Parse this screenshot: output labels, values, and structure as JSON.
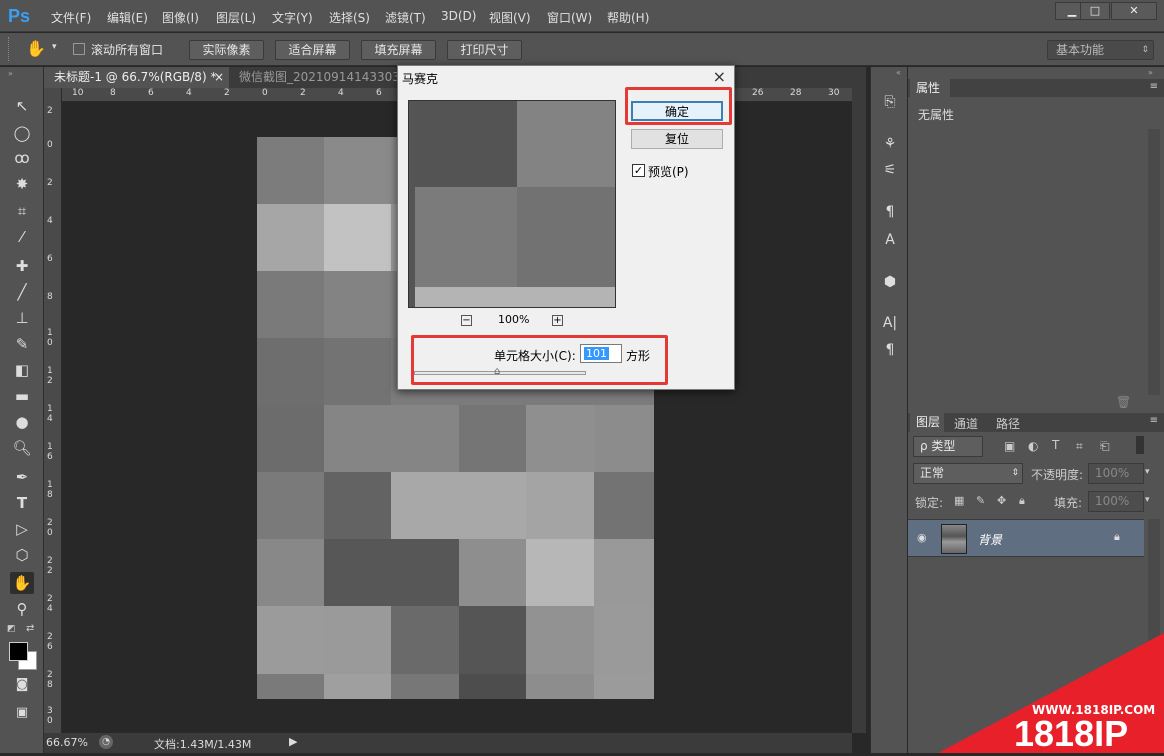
{
  "app": {
    "logo": "Ps"
  },
  "menu": [
    "文件(F)",
    "编辑(E)",
    "图像(I)",
    "图层(L)",
    "文字(Y)",
    "选择(S)",
    "滤镜(T)",
    "3D(D)",
    "视图(V)",
    "窗口(W)",
    "帮助(H)"
  ],
  "window_controls": {
    "minimize": "▁",
    "maximize": "□",
    "close": "✕"
  },
  "options_bar": {
    "tool_icon": "hand-icon",
    "scroll_all_label": "滚动所有窗口",
    "scroll_all_checked": false,
    "buttons": [
      "实际像素",
      "适合屏幕",
      "填充屏幕",
      "打印尺寸"
    ],
    "workspace": "基本功能"
  },
  "tabs": [
    {
      "label": "未标题-1 @ 66.7%(RGB/8) *",
      "close": "×"
    },
    {
      "label": "微信截图_20210914143303..",
      "close": ""
    }
  ],
  "ruler_h": [
    "10",
    "8",
    "6",
    "4",
    "2",
    "0",
    "2",
    "4",
    "6",
    "26",
    "28",
    "30"
  ],
  "ruler_v": [
    "2",
    "0",
    "2",
    "4",
    "6",
    "8",
    "1 0",
    "1 2",
    "1 4",
    "1 6",
    "1 8",
    "2 0",
    "2 2",
    "2 4",
    "2 6",
    "2 8",
    "3 0"
  ],
  "mosaic": {
    "colors": [
      [
        "#7c7c7c",
        "#8a8a8a",
        "#8a8a8a",
        "#8a8a8a",
        "#8a8a8a",
        "#8a8a8a"
      ],
      [
        "#a6a6a6",
        "#c2c2c2",
        "#9a9a9a",
        "#9a9a9a",
        "#9a9a9a",
        "#9a9a9a"
      ],
      [
        "#7a7a7a",
        "#838383",
        "#808080",
        "#808080",
        "#808080",
        "#808080"
      ],
      [
        "#6e6e6e",
        "#737373",
        "#7c7c7c",
        "#7c7c7c",
        "#7c7c7c",
        "#7c7c7c"
      ],
      [
        "#6c6c6c",
        "#858585",
        "#858585",
        "#757575",
        "#8f8f8f",
        "#8c8c8c"
      ],
      [
        "#7a7a7a",
        "#636363",
        "#a8a8a8",
        "#a8a8a8",
        "#a4a4a4",
        "#737373"
      ],
      [
        "#888888",
        "#575757",
        "#575757",
        "#8e8e8e",
        "#b7b7b7",
        "#999999"
      ],
      [
        "#9b9b9b",
        "#9a9a9a",
        "#6a6a6a",
        "#555555",
        "#929292",
        "#9a9a9a"
      ],
      [
        "#7a7a7a",
        "#9f9f9f",
        "#777777",
        "#4d4d4d",
        "#8d8d8d",
        "#9b9b9b"
      ]
    ]
  },
  "status": {
    "zoom": "66.67%",
    "doc": "文档:1.43M/1.43M"
  },
  "properties_panel": {
    "title": "属性",
    "content": "无属性"
  },
  "layers_panel": {
    "tabs": [
      "图层",
      "通道",
      "路径"
    ],
    "kind_filter": "ρ 类型",
    "blend_mode": "正常",
    "opacity_label": "不透明度:",
    "opacity_value": "100%",
    "lock_label": "锁定:",
    "fill_label": "填充:",
    "fill_value": "100%",
    "layers": [
      {
        "name": "背景",
        "locked": true,
        "visible": true
      }
    ]
  },
  "dialog": {
    "title": "马赛克",
    "close": "×",
    "ok_label": "确定",
    "reset_label": "复位",
    "preview_label": "预览(P)",
    "preview_checked": true,
    "zoom_out": "−",
    "zoom_in": "+",
    "zoom_percent": "100%",
    "cell_size_label": "单元格大小(C):",
    "cell_size_value": "101",
    "cell_unit": "方形",
    "preview_colors": [
      "#545454",
      "#838383",
      "#7b7b7b",
      "#727272",
      "#b4b4b4"
    ]
  },
  "watermark": {
    "url": "WWW.1818IP.COM",
    "brand": "1818IP",
    "color": "#e8202a"
  },
  "colors": {
    "accent_red": "#e53935",
    "highlight": "#3399ff",
    "ps_blue": "#3aa0f3"
  }
}
